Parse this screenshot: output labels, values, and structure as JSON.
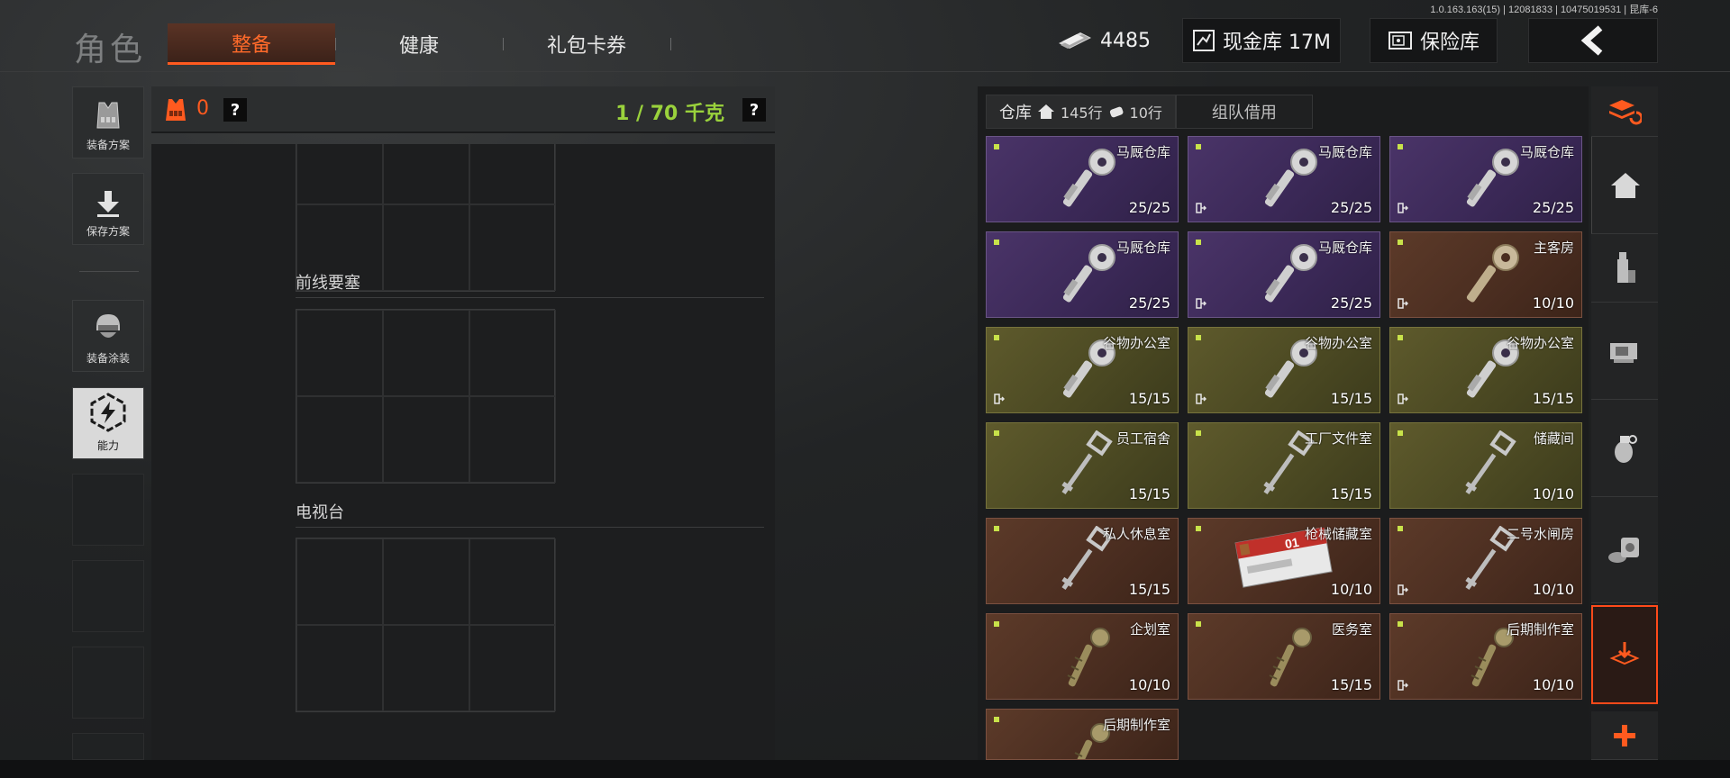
{
  "version": "1.0.163.163(15) | 12081833 | 10475019531 | 昆库-6",
  "header": {
    "title": "角色",
    "tabs": [
      {
        "label": "整备",
        "active": true
      },
      {
        "label": "健康",
        "active": false
      },
      {
        "label": "礼包卡券",
        "active": false
      }
    ],
    "currency": "4485",
    "cash_vault": "现金库 17M",
    "safe_vault": "保险库"
  },
  "left_nav": [
    {
      "label": "装备方案",
      "icon": "vest-icon"
    },
    {
      "label": "保存方案",
      "icon": "download-icon"
    },
    {
      "label": "装备涂装",
      "icon": "helmet-icon"
    },
    {
      "label": "能力",
      "icon": "ability-icon",
      "active": true
    }
  ],
  "loadout": {
    "armor_count": "0",
    "help": "?",
    "weight": "1 / 70 千克",
    "sections": [
      "前线要塞",
      "电视台"
    ]
  },
  "warehouse": {
    "tab_label": "仓库",
    "rows_a": "145行",
    "rows_b": "10行",
    "team_tab": "组队借用",
    "items": [
      {
        "name": "马厩仓库",
        "count": "25/25",
        "color": "purple",
        "exit": false,
        "key": "silver"
      },
      {
        "name": "马厩仓库",
        "count": "25/25",
        "color": "purple",
        "exit": true,
        "key": "silver"
      },
      {
        "name": "马厩仓库",
        "count": "25/25",
        "color": "purple",
        "exit": true,
        "key": "silver"
      },
      {
        "name": "马厩仓库",
        "count": "25/25",
        "color": "purple",
        "exit": false,
        "key": "silver"
      },
      {
        "name": "马厩仓库",
        "count": "25/25",
        "color": "purple",
        "exit": true,
        "key": "silver"
      },
      {
        "name": "主客房",
        "count": "10/10",
        "color": "brown",
        "exit": true,
        "key": "gold"
      },
      {
        "name": "谷物办公室",
        "count": "15/15",
        "color": "olive",
        "exit": true,
        "key": "silver"
      },
      {
        "name": "谷物办公室",
        "count": "15/15",
        "color": "olive",
        "exit": true,
        "key": "silver"
      },
      {
        "name": "谷物办公室",
        "count": "15/15",
        "color": "olive",
        "exit": true,
        "key": "silver"
      },
      {
        "name": "员工宿舍",
        "count": "15/15",
        "color": "olive",
        "exit": false,
        "key": "thin"
      },
      {
        "name": "工厂文件室",
        "count": "15/15",
        "color": "olive",
        "exit": false,
        "key": "thin"
      },
      {
        "name": "储藏间",
        "count": "10/10",
        "color": "olive",
        "exit": false,
        "key": "thin"
      },
      {
        "name": "私人休息室",
        "count": "15/15",
        "color": "brown",
        "exit": false,
        "key": "thin"
      },
      {
        "name": "枪械储藏室",
        "count": "10/10",
        "color": "brown",
        "exit": false,
        "key": "card"
      },
      {
        "name": "二号水闸房",
        "count": "10/10",
        "color": "brown",
        "exit": true,
        "key": "thin"
      },
      {
        "name": "企划室",
        "count": "10/10",
        "color": "brown",
        "exit": false,
        "key": "brass"
      },
      {
        "name": "医务室",
        "count": "15/15",
        "color": "brown",
        "exit": false,
        "key": "brass"
      },
      {
        "name": "后期制作室",
        "count": "10/10",
        "color": "brown",
        "exit": true,
        "key": "brass"
      },
      {
        "name": "后期制作室",
        "count": "",
        "color": "brown",
        "exit": false,
        "key": "brass"
      }
    ]
  },
  "right_nav": [
    "sort-icon",
    "home-icon",
    "bottle-icon",
    "scope-icon",
    "grenade-icon",
    "tape-icon",
    "deposit-icon",
    "plus-icon"
  ],
  "colors": {
    "accent": "#ff5a1f",
    "weight_green": "#9ad23c",
    "card_purple": "#3a2856",
    "card_olive": "#4a4822",
    "card_brown": "#4a2d20"
  }
}
